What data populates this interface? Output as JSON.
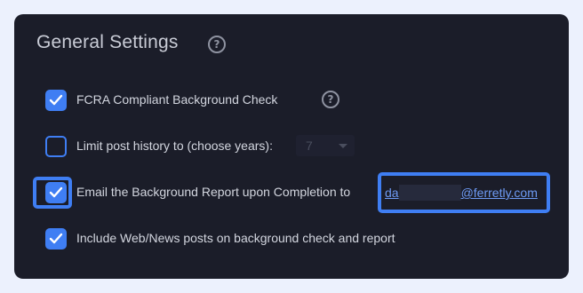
{
  "section": {
    "title": "General Settings",
    "help_icon": "question-circle-icon"
  },
  "options": [
    {
      "label": "FCRA Compliant Background Check",
      "checked": true,
      "help_icon": "question-circle-icon"
    },
    {
      "label": "Limit post history to (choose years):",
      "checked": false,
      "select_value": "7"
    },
    {
      "label": "Email the Background Report upon Completion to",
      "checked": true,
      "email_prefix": "da",
      "email_domain": "@ferretly.com"
    },
    {
      "label": "Include Web/News posts on background check and report",
      "checked": true
    }
  ],
  "colors": {
    "accent": "#3f7ef3",
    "panel": "#1b1d29",
    "page": "#ecf1fd",
    "link": "#6e9bf5"
  },
  "icons": {
    "check": "checkmark-icon",
    "help": "question-circle-icon",
    "dropdown": "caret-down-icon"
  }
}
